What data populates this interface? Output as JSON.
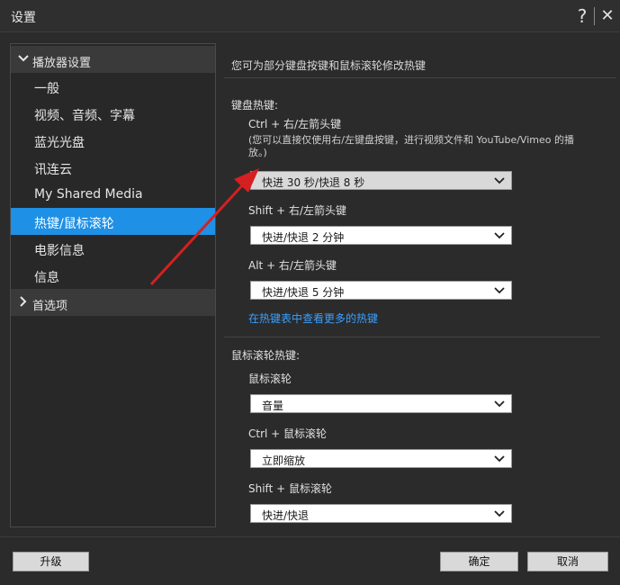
{
  "window": {
    "title": "设置",
    "help": "?",
    "close": "✕"
  },
  "sidebar": {
    "group1": "播放器设置",
    "items": [
      {
        "label": "一般"
      },
      {
        "label": "视频、音频、字幕"
      },
      {
        "label": "蓝光光盘"
      },
      {
        "label": "讯连云"
      },
      {
        "label": "My Shared Media"
      },
      {
        "label": "热键/鼠标滚轮",
        "active": true
      },
      {
        "label": "电影信息"
      },
      {
        "label": "信息"
      }
    ],
    "group2": "首选项"
  },
  "content": {
    "intro": "您可为部分键盘按键和鼠标滚轮修改热键",
    "keyboard": {
      "title": "键盘热键:",
      "ctrl_label": "Ctrl + 右/左箭头键",
      "ctrl_note": "(您可以直接仅使用右/左键盘按键，进行视频文件和 YouTube/Vimeo 的播放。)",
      "ctrl_value": "快进 30 秒/快退 8 秒",
      "shift_label": "Shift + 右/左箭头键",
      "shift_value": "快进/快退 2 分钟",
      "alt_label": "Alt + 右/左箭头键",
      "alt_value": "快进/快退 5 分钟",
      "more_link": "在热键表中查看更多的热键"
    },
    "mouse": {
      "title": "鼠标滚轮热键:",
      "wheel_label": "鼠标滚轮",
      "wheel_value": "音量",
      "ctrl_label": "Ctrl + 鼠标滚轮",
      "ctrl_value": "立即缩放",
      "shift_label": "Shift + 鼠标滚轮",
      "shift_value": "快进/快退"
    }
  },
  "footer": {
    "upgrade": "升级",
    "ok": "确定",
    "cancel": "取消"
  },
  "colors": {
    "accent": "#1e90e6",
    "link": "#3aa0ff",
    "annotation_arrow": "#d42020"
  }
}
